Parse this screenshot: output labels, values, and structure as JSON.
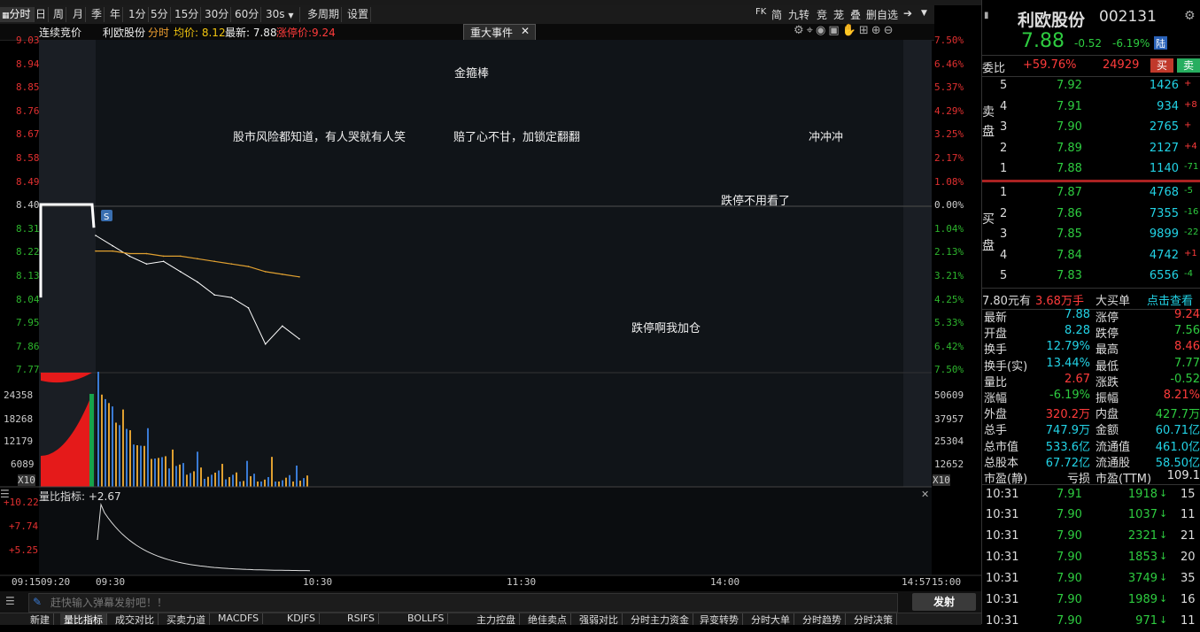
{
  "periods": [
    "分时",
    "日",
    "周",
    "月",
    "季",
    "年",
    "1分",
    "5分",
    "15分",
    "30分",
    "60分",
    "30s",
    "多周期",
    "设置"
  ],
  "top_tools": [
    "FK",
    "简",
    "九转",
    "竞",
    "茏",
    "叠",
    "删自选"
  ],
  "chart_header": {
    "auction_label": "连续竞价",
    "stock_name": "利欧股份",
    "time_share_label": "分时",
    "avg_label": "均价: 8.12",
    "latest_label": "最新: 7.88",
    "limit_up_label": "涨停价:9.24",
    "event_label": "重大事件"
  },
  "price_axis_left": [
    "9.03",
    "8.94",
    "8.85",
    "8.76",
    "8.67",
    "8.58",
    "8.49",
    "8.40",
    "8.31",
    "8.22",
    "8.13",
    "8.04",
    "7.95",
    "7.86",
    "7.77"
  ],
  "pct_axis_right": [
    "7.50%",
    "6.46%",
    "5.37%",
    "4.29%",
    "3.25%",
    "2.17%",
    "1.08%",
    "0.00%",
    "1.04%",
    "2.13%",
    "3.21%",
    "4.25%",
    "5.33%",
    "6.42%",
    "7.50%"
  ],
  "volume_axis_left": [
    "24358",
    "18268",
    "12179",
    "6089",
    "X10"
  ],
  "volume_axis_right": [
    "50609",
    "37957",
    "25304",
    "12652",
    "X10"
  ],
  "volume_top_left": "24358",
  "ratio_indicator": {
    "label": "量比指标: +2.67",
    "ticks": [
      "+10.22",
      "+7.74",
      "+5.25"
    ]
  },
  "time_axis": [
    "09:15",
    "09:20",
    "09:30",
    "10:30",
    "11:30",
    "14:00",
    "14:57",
    "15:00"
  ],
  "bullets": [
    "金箍棒",
    "股市风险都知道，有人哭就有人笑",
    "赔了心不甘，加锁定翻翻",
    "冲冲冲",
    "跌停不用看了",
    "跌停啊我加仓"
  ],
  "chart_data": {
    "type": "line",
    "title": "利欧股份 分时",
    "x": [
      "09:30",
      "09:35",
      "09:40",
      "09:45",
      "09:50",
      "09:55",
      "10:00",
      "10:05",
      "10:10",
      "10:15",
      "10:20",
      "10:25",
      "10:30"
    ],
    "series": [
      {
        "name": "最新",
        "values": [
          8.28,
          8.24,
          8.2,
          8.17,
          8.18,
          8.14,
          8.1,
          8.05,
          8.04,
          8.0,
          7.86,
          7.93,
          7.88
        ]
      },
      {
        "name": "均价",
        "values": [
          8.22,
          8.22,
          8.21,
          8.21,
          8.2,
          8.2,
          8.19,
          8.18,
          8.17,
          8.16,
          8.14,
          8.13,
          8.12
        ]
      }
    ],
    "prev_close": 8.4,
    "ylim": [
      7.77,
      9.03
    ]
  },
  "side": {
    "title": "利欧股份",
    "code": "002131",
    "price": "7.88",
    "change": "-0.52",
    "change_pct": "-6.19%",
    "market_tag": "陆",
    "weibi_label": "委比",
    "weibi_pct": "+59.76%",
    "weibi_val": "24929",
    "buy_btn": "买",
    "sell_btn": "卖",
    "sell_side_label": "卖盘",
    "buy_side_label": "买盘",
    "asks": [
      {
        "lvl": "5",
        "price": "7.92",
        "vol": "1426",
        "chg": "+"
      },
      {
        "lvl": "4",
        "price": "7.91",
        "vol": "934",
        "chg": "+8"
      },
      {
        "lvl": "3",
        "price": "7.90",
        "vol": "2765",
        "chg": "+"
      },
      {
        "lvl": "2",
        "price": "7.89",
        "vol": "2127",
        "chg": "+4"
      },
      {
        "lvl": "1",
        "price": "7.88",
        "vol": "1140",
        "chg": "-71"
      }
    ],
    "bids": [
      {
        "lvl": "1",
        "price": "7.87",
        "vol": "4768",
        "chg": "-5"
      },
      {
        "lvl": "2",
        "price": "7.86",
        "vol": "7355",
        "chg": "-16"
      },
      {
        "lvl": "3",
        "price": "7.85",
        "vol": "9899",
        "chg": "-22"
      },
      {
        "lvl": "4",
        "price": "7.84",
        "vol": "4742",
        "chg": "+1"
      },
      {
        "lvl": "5",
        "price": "7.83",
        "vol": "6556",
        "chg": "-4"
      }
    ],
    "big_order": {
      "price": "7.80元有",
      "amount": "3.68万手",
      "label": "大买单",
      "link": "点击查看"
    },
    "stats": [
      {
        "l1": "最新",
        "v1": "7.88",
        "l2": "涨停",
        "v2": "9.24"
      },
      {
        "l1": "开盘",
        "v1": "8.28",
        "l2": "跌停",
        "v2": "7.56"
      },
      {
        "l1": "换手",
        "v1": "12.79%",
        "l2": "最高",
        "v2": "8.46"
      },
      {
        "l1": "换手(实)",
        "v1": "13.44%",
        "l2": "最低",
        "v2": "7.77"
      },
      {
        "l1": "量比",
        "v1": "2.67",
        "l2": "涨跌",
        "v2": "-0.52"
      },
      {
        "l1": "涨幅",
        "v1": "-6.19%",
        "l2": "振幅",
        "v2": "8.21%"
      },
      {
        "l1": "外盘",
        "v1": "320.2万",
        "l2": "内盘",
        "v2": "427.7万"
      },
      {
        "l1": "总手",
        "v1": "747.9万",
        "l2": "金额",
        "v2": "60.71亿"
      },
      {
        "l1": "总市值",
        "v1": "533.6亿",
        "l2": "流通值",
        "v2": "461.0亿"
      },
      {
        "l1": "总股本",
        "v1": "67.72亿",
        "l2": "流通股",
        "v2": "58.50亿"
      },
      {
        "l1": "市盈(静)",
        "v1": "亏损",
        "l2": "市盈(TTM)",
        "v2": "109.1"
      }
    ],
    "ticks": [
      {
        "t": "10:31",
        "p": "7.91",
        "v": "1918",
        "n": "15"
      },
      {
        "t": "10:31",
        "p": "7.90",
        "v": "1037",
        "n": "11"
      },
      {
        "t": "10:31",
        "p": "7.90",
        "v": "2321",
        "n": "21"
      },
      {
        "t": "10:31",
        "p": "7.90",
        "v": "1853",
        "n": "20"
      },
      {
        "t": "10:31",
        "p": "7.90",
        "v": "3749",
        "n": "35"
      },
      {
        "t": "10:31",
        "p": "7.90",
        "v": "1989",
        "n": "16"
      },
      {
        "t": "10:31",
        "p": "7.90",
        "v": "971",
        "n": "11"
      }
    ]
  },
  "input": {
    "placeholder": "赶快输入弹幕发射吧！！",
    "send": "发射"
  },
  "tabs": [
    "新建",
    "量比指标",
    "成交对比",
    "买卖力道",
    "MACDFS",
    "KDJFS",
    "RSIFS",
    "BOLLFS",
    "主力控盘",
    "绝佳卖点",
    "强弱对比",
    "分时主力资金",
    "异变转势",
    "分时大单",
    "分时趋势",
    "分时决策"
  ]
}
